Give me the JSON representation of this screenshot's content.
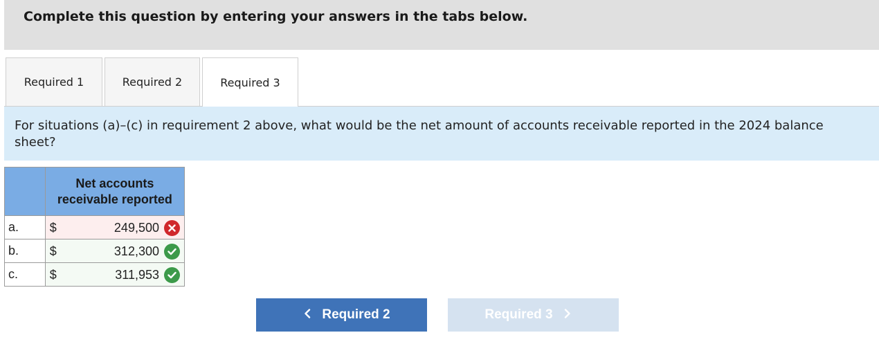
{
  "banner": {
    "text": "Complete this question by entering your answers in the tabs below."
  },
  "tabs": [
    {
      "label": "Required 1"
    },
    {
      "label": "Required 2"
    },
    {
      "label": "Required 3"
    }
  ],
  "prompt": {
    "text": "For situations (a)–(c) in requirement 2 above, what would be the net amount of accounts receivable reported in the 2024 balance sheet?"
  },
  "table": {
    "header": "Net accounts receivable reported",
    "rows": [
      {
        "label": "a.",
        "currency": "$",
        "value": "249,500",
        "status": "incorrect",
        "status_icon": "x-icon"
      },
      {
        "label": "b.",
        "currency": "$",
        "value": "312,300",
        "status": "correct",
        "status_icon": "check-icon"
      },
      {
        "label": "c.",
        "currency": "$",
        "value": "311,953",
        "status": "correct",
        "status_icon": "check-icon"
      }
    ]
  },
  "nav": {
    "prev_label": "Required 2",
    "prev_icon": "chevron-left-icon",
    "next_label": "Required 3",
    "next_icon": "chevron-right-icon",
    "next_disabled": true
  },
  "colors": {
    "banner_bg": "#e0e0e0",
    "prompt_bg": "#d9ecf9",
    "table_header_bg": "#7aace4",
    "error_red": "#d0282c",
    "success_green": "#3c9a4a",
    "primary_button": "#3f73b8",
    "disabled_button": "#d5e2f0"
  }
}
